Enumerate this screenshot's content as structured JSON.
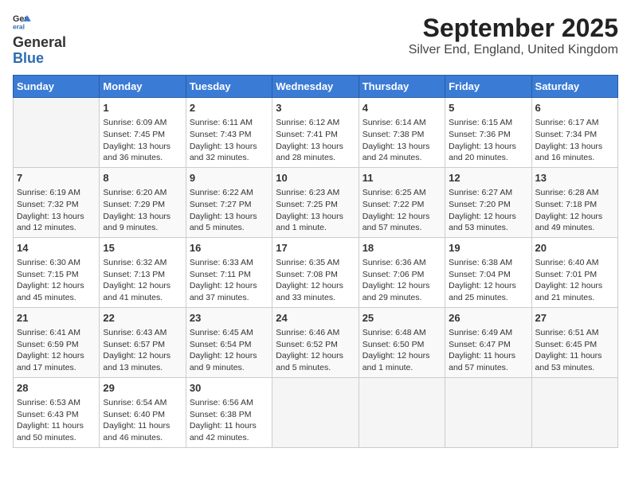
{
  "logo": {
    "text_general": "General",
    "text_blue": "Blue"
  },
  "title": "September 2025",
  "subtitle": "Silver End, England, United Kingdom",
  "days_of_week": [
    "Sunday",
    "Monday",
    "Tuesday",
    "Wednesday",
    "Thursday",
    "Friday",
    "Saturday"
  ],
  "weeks": [
    [
      {
        "day": "",
        "info": ""
      },
      {
        "day": "1",
        "info": "Sunrise: 6:09 AM\nSunset: 7:45 PM\nDaylight: 13 hours and 36 minutes."
      },
      {
        "day": "2",
        "info": "Sunrise: 6:11 AM\nSunset: 7:43 PM\nDaylight: 13 hours and 32 minutes."
      },
      {
        "day": "3",
        "info": "Sunrise: 6:12 AM\nSunset: 7:41 PM\nDaylight: 13 hours and 28 minutes."
      },
      {
        "day": "4",
        "info": "Sunrise: 6:14 AM\nSunset: 7:38 PM\nDaylight: 13 hours and 24 minutes."
      },
      {
        "day": "5",
        "info": "Sunrise: 6:15 AM\nSunset: 7:36 PM\nDaylight: 13 hours and 20 minutes."
      },
      {
        "day": "6",
        "info": "Sunrise: 6:17 AM\nSunset: 7:34 PM\nDaylight: 13 hours and 16 minutes."
      }
    ],
    [
      {
        "day": "7",
        "info": "Sunrise: 6:19 AM\nSunset: 7:32 PM\nDaylight: 13 hours and 12 minutes."
      },
      {
        "day": "8",
        "info": "Sunrise: 6:20 AM\nSunset: 7:29 PM\nDaylight: 13 hours and 9 minutes."
      },
      {
        "day": "9",
        "info": "Sunrise: 6:22 AM\nSunset: 7:27 PM\nDaylight: 13 hours and 5 minutes."
      },
      {
        "day": "10",
        "info": "Sunrise: 6:23 AM\nSunset: 7:25 PM\nDaylight: 13 hours and 1 minute."
      },
      {
        "day": "11",
        "info": "Sunrise: 6:25 AM\nSunset: 7:22 PM\nDaylight: 12 hours and 57 minutes."
      },
      {
        "day": "12",
        "info": "Sunrise: 6:27 AM\nSunset: 7:20 PM\nDaylight: 12 hours and 53 minutes."
      },
      {
        "day": "13",
        "info": "Sunrise: 6:28 AM\nSunset: 7:18 PM\nDaylight: 12 hours and 49 minutes."
      }
    ],
    [
      {
        "day": "14",
        "info": "Sunrise: 6:30 AM\nSunset: 7:15 PM\nDaylight: 12 hours and 45 minutes."
      },
      {
        "day": "15",
        "info": "Sunrise: 6:32 AM\nSunset: 7:13 PM\nDaylight: 12 hours and 41 minutes."
      },
      {
        "day": "16",
        "info": "Sunrise: 6:33 AM\nSunset: 7:11 PM\nDaylight: 12 hours and 37 minutes."
      },
      {
        "day": "17",
        "info": "Sunrise: 6:35 AM\nSunset: 7:08 PM\nDaylight: 12 hours and 33 minutes."
      },
      {
        "day": "18",
        "info": "Sunrise: 6:36 AM\nSunset: 7:06 PM\nDaylight: 12 hours and 29 minutes."
      },
      {
        "day": "19",
        "info": "Sunrise: 6:38 AM\nSunset: 7:04 PM\nDaylight: 12 hours and 25 minutes."
      },
      {
        "day": "20",
        "info": "Sunrise: 6:40 AM\nSunset: 7:01 PM\nDaylight: 12 hours and 21 minutes."
      }
    ],
    [
      {
        "day": "21",
        "info": "Sunrise: 6:41 AM\nSunset: 6:59 PM\nDaylight: 12 hours and 17 minutes."
      },
      {
        "day": "22",
        "info": "Sunrise: 6:43 AM\nSunset: 6:57 PM\nDaylight: 12 hours and 13 minutes."
      },
      {
        "day": "23",
        "info": "Sunrise: 6:45 AM\nSunset: 6:54 PM\nDaylight: 12 hours and 9 minutes."
      },
      {
        "day": "24",
        "info": "Sunrise: 6:46 AM\nSunset: 6:52 PM\nDaylight: 12 hours and 5 minutes."
      },
      {
        "day": "25",
        "info": "Sunrise: 6:48 AM\nSunset: 6:50 PM\nDaylight: 12 hours and 1 minute."
      },
      {
        "day": "26",
        "info": "Sunrise: 6:49 AM\nSunset: 6:47 PM\nDaylight: 11 hours and 57 minutes."
      },
      {
        "day": "27",
        "info": "Sunrise: 6:51 AM\nSunset: 6:45 PM\nDaylight: 11 hours and 53 minutes."
      }
    ],
    [
      {
        "day": "28",
        "info": "Sunrise: 6:53 AM\nSunset: 6:43 PM\nDaylight: 11 hours and 50 minutes."
      },
      {
        "day": "29",
        "info": "Sunrise: 6:54 AM\nSunset: 6:40 PM\nDaylight: 11 hours and 46 minutes."
      },
      {
        "day": "30",
        "info": "Sunrise: 6:56 AM\nSunset: 6:38 PM\nDaylight: 11 hours and 42 minutes."
      },
      {
        "day": "",
        "info": ""
      },
      {
        "day": "",
        "info": ""
      },
      {
        "day": "",
        "info": ""
      },
      {
        "day": "",
        "info": ""
      }
    ]
  ]
}
